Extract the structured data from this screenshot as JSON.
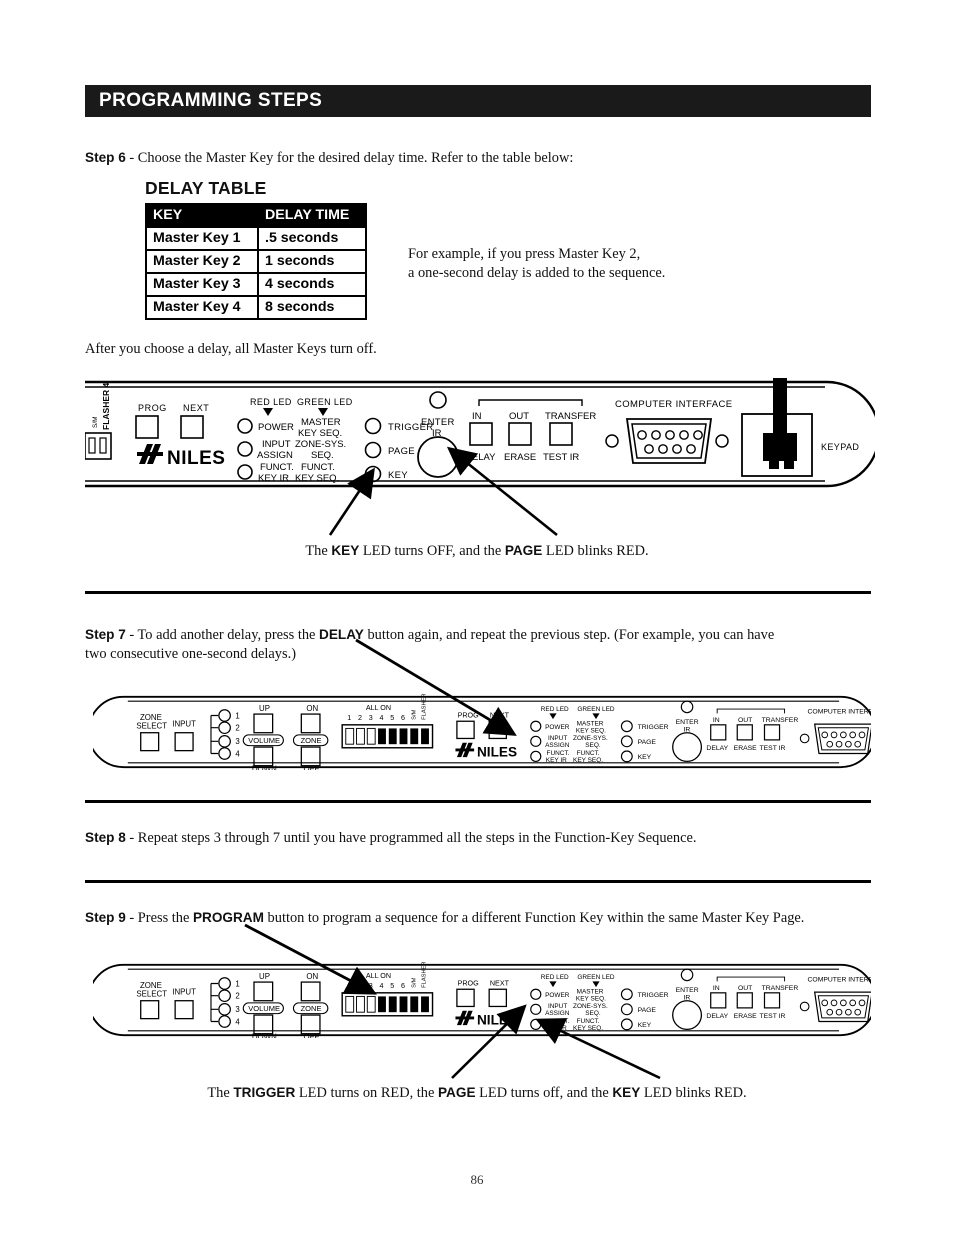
{
  "header": {
    "title": "PROGRAMMING STEPS"
  },
  "steps": {
    "step6": {
      "label": "Step 6",
      "text": " - Choose the Master Key for the desired delay time. Refer to the table below:"
    },
    "step7_line1_a": "Step 7",
    "step7_line1_b": " - To add another delay, press the ",
    "step7_bold": "DELAY",
    "step7_line1_c": " button again, and repeat the previous step. (For example, you can have",
    "step7_line2": "two consecutive one-second delays.)",
    "step8": {
      "label": "Step 8",
      "text": " - Repeat steps 3 through 7 until you have programmed all the steps in the Function-Key Sequence."
    },
    "step9_a": "Step 9",
    "step9_b": " - Press the ",
    "step9_bold": "PROGRAM",
    "step9_c": " button to program a sequence for a different Function Key within the same Master Key Page."
  },
  "delay_table": {
    "title": "DELAY TABLE",
    "headers": [
      "KEY",
      "DELAY TIME"
    ],
    "rows": [
      [
        "Master Key 1",
        ".5 seconds"
      ],
      [
        "Master Key 2",
        "1 seconds"
      ],
      [
        "Master Key 3",
        "4 seconds"
      ],
      [
        "Master Key 4",
        "8 seconds"
      ]
    ]
  },
  "example_note": {
    "line1": "For example, if you press Master Key 2,",
    "line2": "a one-second delay is added to the sequence."
  },
  "after_delay_note": "After you choose a delay, all Master Keys turn off.",
  "captions": {
    "caption1_a": "The ",
    "caption1_b1": "KEY",
    "caption1_c": " LED turns OFF, and the ",
    "caption1_b2": "PAGE",
    "caption1_d": " LED blinks RED.",
    "caption3_a": "The ",
    "caption3_b1": "TRIGGER",
    "caption3_c": " LED turns on RED, the ",
    "caption3_b2": "PAGE",
    "caption3_d": " LED turns off, and the ",
    "caption3_b3": "KEY",
    "caption3_e": " LED blinks RED."
  },
  "device_panel": {
    "brand": "NILES",
    "zone_select": "ZONE\nSELECT",
    "zone_select_l1": "ZONE",
    "zone_select_l2": "SELECT",
    "input": "INPUT",
    "zone_numbers": [
      "1",
      "2",
      "3",
      "4"
    ],
    "volume_up": "UP",
    "volume_down": "DOWN",
    "volume_label": "VOLUME",
    "zone_on": "ON",
    "zone_off": "OFF",
    "zone_label": "ZONE",
    "dip": {
      "all_on": "ALL ON",
      "numbers": [
        "1",
        "2",
        "3",
        "4",
        "5",
        "6"
      ],
      "sm": "S/M",
      "flasher4": "FLASHER 4"
    },
    "prog": "PROG",
    "next": "NEXT",
    "red_led": "RED LED",
    "green_led": "GREEN LED",
    "led_rows": [
      {
        "red": "POWER",
        "green_l1": "MASTER",
        "green_l2": "KEY SEQ."
      },
      {
        "red_l1": "INPUT",
        "red_l2": "ASSIGN",
        "green_l1": "ZONE-SYS.",
        "green_l2": "SEQ."
      },
      {
        "red_l1": "FUNCT.",
        "red_l2": "KEY IR",
        "green_l1": "FUNCT.",
        "green_l2": "KEY SEQ."
      }
    ],
    "status_leds": [
      "TRIGGER",
      "PAGE",
      "KEY"
    ],
    "enter_ir_l1": "ENTER",
    "enter_ir_l2": "IR",
    "buttons_top": [
      "IN",
      "OUT",
      "TRANSFER"
    ],
    "buttons_bottom": [
      "DELAY",
      "ERASE",
      "TEST IR"
    ],
    "computer_interface": "COMPUTER INTERFACE",
    "keypad": "KEYPAD"
  },
  "page_number": "86",
  "colors": {
    "ink": "#000000",
    "header_bg": "#1a1a1a",
    "paper": "#ffffff"
  }
}
